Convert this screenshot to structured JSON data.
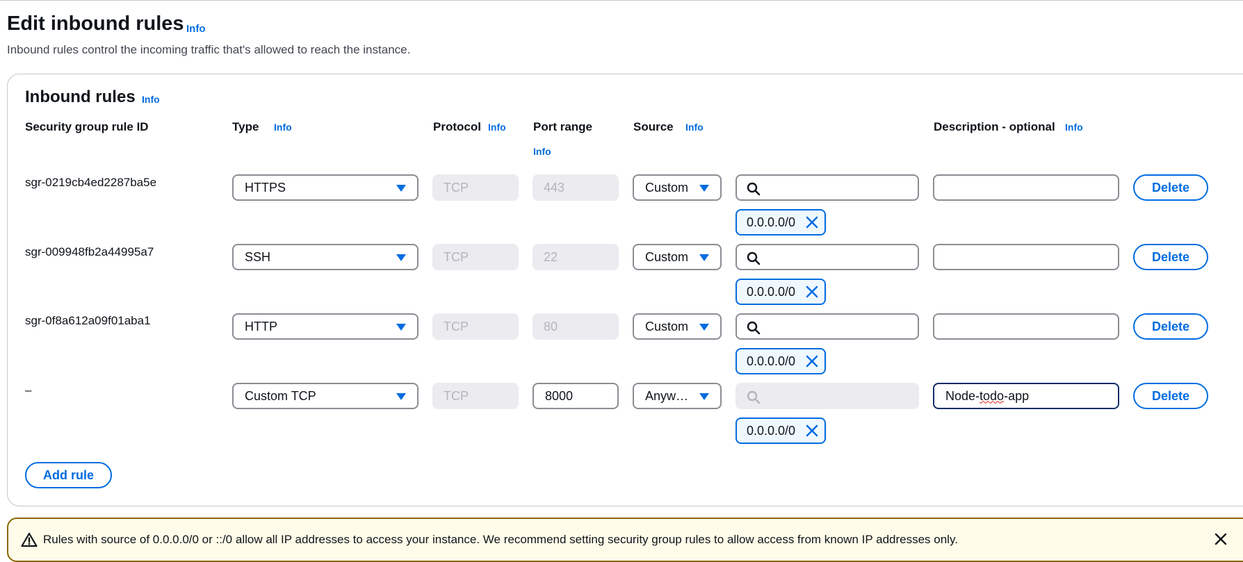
{
  "page": {
    "title": "Edit inbound rules",
    "info_label": "Info",
    "description": "Inbound rules control the incoming traffic that's allowed to reach the instance."
  },
  "panel": {
    "title": "Inbound rules",
    "info_label": "Info",
    "columns": {
      "rule_id": "Security group rule ID",
      "type": "Type",
      "protocol": "Protocol",
      "port_range": "Port range",
      "source": "Source",
      "description": "Description - optional"
    }
  },
  "rules": [
    {
      "rule_id": "sgr-0219cb4ed2287ba5e",
      "type": "HTTPS",
      "protocol": "TCP",
      "port_range": "443",
      "source": "Custom",
      "cidr": "0.0.0.0/0",
      "description": "",
      "delete_label": "Delete"
    },
    {
      "rule_id": "sgr-009948fb2a44995a7",
      "type": "SSH",
      "protocol": "TCP",
      "port_range": "22",
      "source": "Custom",
      "cidr": "0.0.0.0/0",
      "description": "",
      "delete_label": "Delete"
    },
    {
      "rule_id": "sgr-0f8a612a09f01aba1",
      "type": "HTTP",
      "protocol": "TCP",
      "port_range": "80",
      "source": "Custom",
      "cidr": "0.0.0.0/0",
      "description": "",
      "delete_label": "Delete"
    },
    {
      "rule_id": "–",
      "type": "Custom TCP",
      "protocol": "TCP",
      "port_range": "8000",
      "source": "Anyw…",
      "cidr": "0.0.0.0/0",
      "description_part1": "Node-",
      "description_part2": "todo",
      "description_part3": "-app",
      "delete_label": "Delete"
    }
  ],
  "add_rule_label": "Add rule",
  "alert": {
    "text": "Rules with source of 0.0.0.0/0 or ::/0 allow all IP addresses to access your instance. We recommend setting security group rules to allow access from known IP addresses only."
  },
  "colors": {
    "accent": "#006ce0",
    "warning_border": "#8d6605",
    "warning_background": "#fffce9"
  }
}
